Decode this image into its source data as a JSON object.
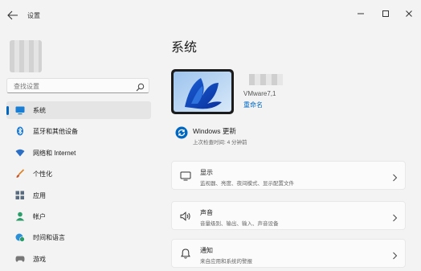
{
  "window": {
    "title": "设置"
  },
  "sidebar": {
    "search_placeholder": "查找设置",
    "items": [
      {
        "label": "系统",
        "icon": "monitor-icon",
        "active": true
      },
      {
        "label": "蓝牙和其他设备",
        "icon": "bluetooth-icon"
      },
      {
        "label": "网络和 Internet",
        "icon": "wifi-icon"
      },
      {
        "label": "个性化",
        "icon": "brush-icon"
      },
      {
        "label": "应用",
        "icon": "apps-icon"
      },
      {
        "label": "帐户",
        "icon": "account-icon"
      },
      {
        "label": "时间和语言",
        "icon": "globe-clock-icon"
      },
      {
        "label": "游戏",
        "icon": "game-controller-icon"
      }
    ]
  },
  "main": {
    "title": "系统",
    "device": {
      "name": "VMware7,1",
      "rename_label": "重命名"
    },
    "update": {
      "title": "Windows 更新",
      "subtitle": "上次检查时间: 4 分钟前"
    },
    "cards": [
      {
        "title": "显示",
        "subtitle": "监视器、亮度、夜间模式、显示配置文件",
        "icon": "display-icon"
      },
      {
        "title": "声音",
        "subtitle": "音量级别、输出、输入、声音设备",
        "icon": "speaker-icon"
      },
      {
        "title": "通知",
        "subtitle": "来自应用和系统的警报",
        "icon": "bell-icon"
      }
    ]
  },
  "colors": {
    "accent": "#0067c0",
    "background": "#f3f3f3",
    "card": "#fbfbfb",
    "update_icon": "#0067c0"
  }
}
